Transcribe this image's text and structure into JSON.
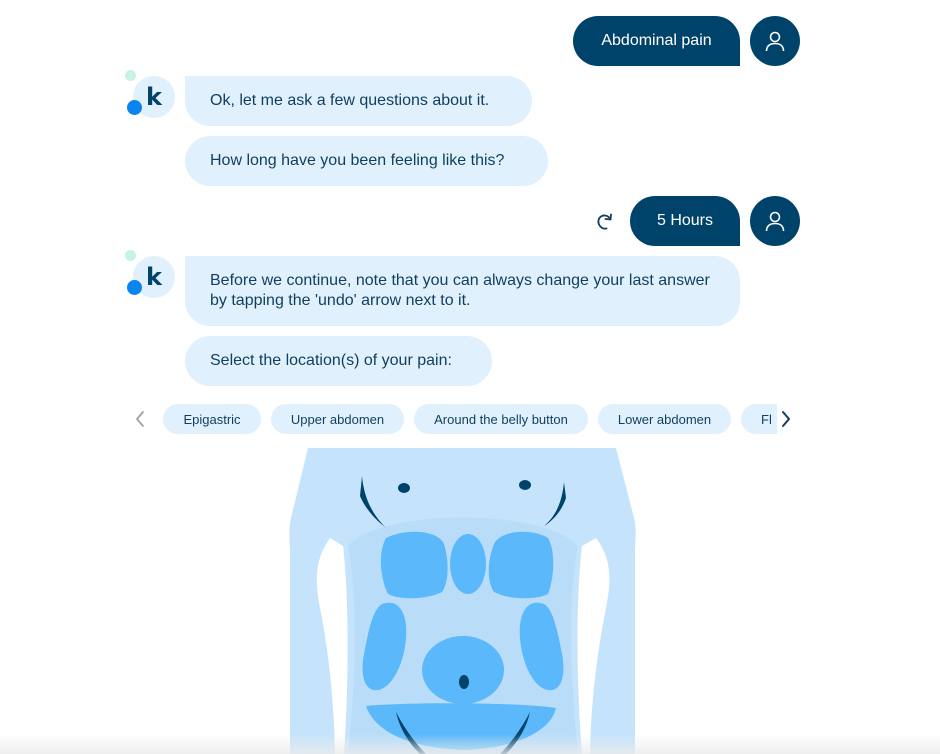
{
  "conversation": {
    "user_msg_1": "Abdominal pain",
    "bot_msg_1": "Ok, let me ask a few questions about it.",
    "bot_msg_2": "How long have you been feeling like this?",
    "user_msg_2": "5 Hours",
    "bot_msg_3": "Before we continue, note that you can always change your last answer by tapping the 'undo' arrow next to it.",
    "bot_msg_4": "Select the location(s) of your pain:"
  },
  "bot_avatar": {
    "letter": "k"
  },
  "icons": {
    "user_avatar": "person-icon",
    "undo": "undo-arrow-icon",
    "prev": "chevron-left-icon",
    "next": "chevron-right-icon"
  },
  "location_options": [
    "Epigastric",
    "Upper abdomen",
    "Around the belly button",
    "Lower abdomen",
    "Fl"
  ],
  "colors": {
    "user_bubble": "#00436a",
    "bot_bubble": "#e0f1fd",
    "bot_text": "#0f3e5f",
    "body_fill": "#c5e4fb",
    "region_fill": "#5ab8fb",
    "accent_dark": "#00436a"
  }
}
